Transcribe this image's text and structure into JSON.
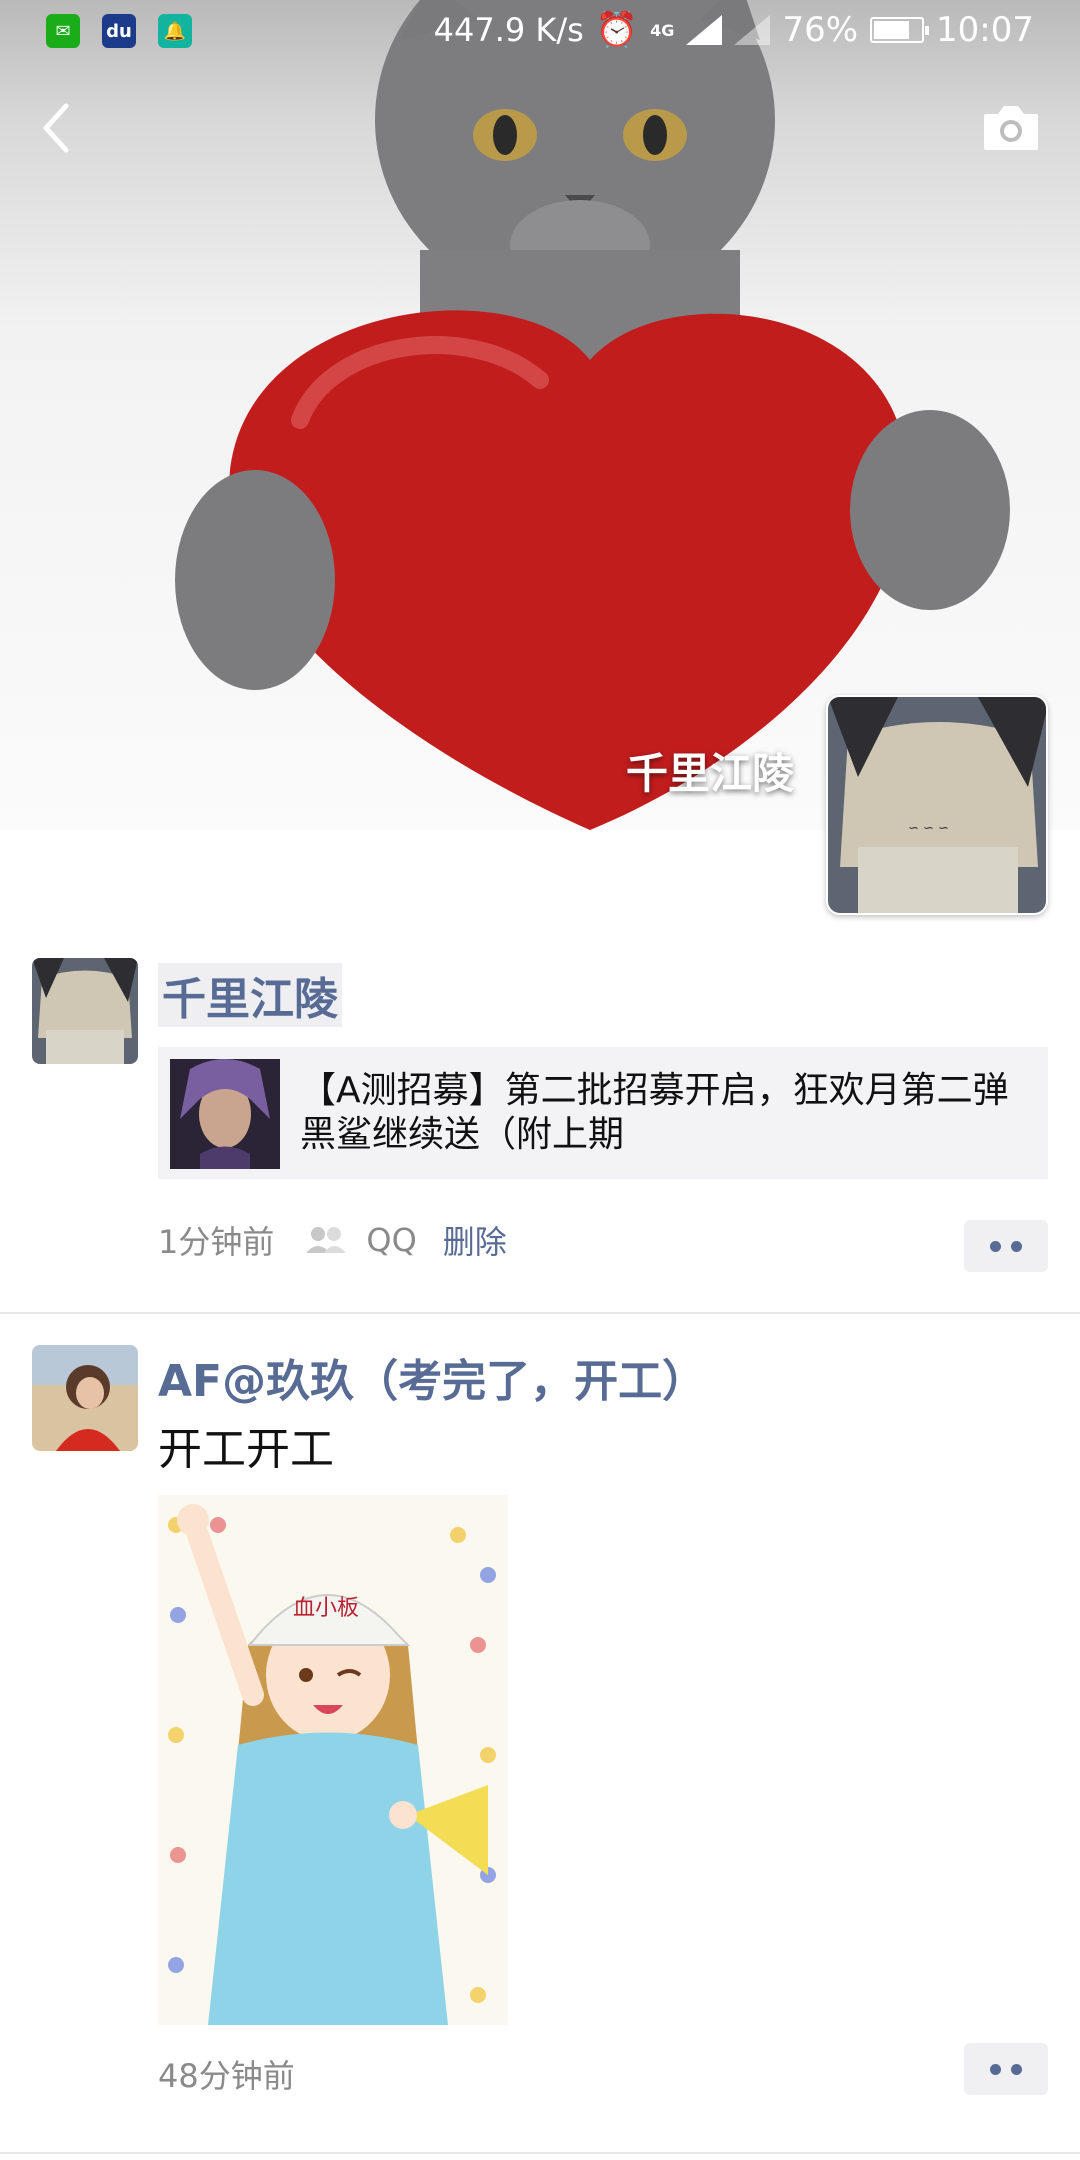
{
  "status_bar": {
    "net_speed": "447.9 K/s",
    "network": "4G",
    "battery_percent": "76%",
    "battery_level": 0.76,
    "time": "10:07",
    "apps": [
      "wechat-icon",
      "baidu-icon",
      "notification-bell-icon"
    ]
  },
  "nav": {
    "back_icon": "chevron-left-icon",
    "camera_icon": "camera-icon"
  },
  "cover": {
    "user_name": "千里江陵"
  },
  "posts": [
    {
      "author": "千里江陵",
      "link": {
        "title": "【A测招募】第二批招募开启，狂欢月第二弹黑鲨继续送（附上期"
      },
      "time": "1分钟前",
      "privacy_icon": "contacts-icon",
      "source": "QQ",
      "delete_label": "删除"
    },
    {
      "author": "AF@玖玖（考完了，开工）",
      "text": "开工开工",
      "time": "48分钟前"
    }
  ],
  "colors": {
    "name_blue": "#576b95",
    "meta_grey": "#8a8a8a"
  }
}
